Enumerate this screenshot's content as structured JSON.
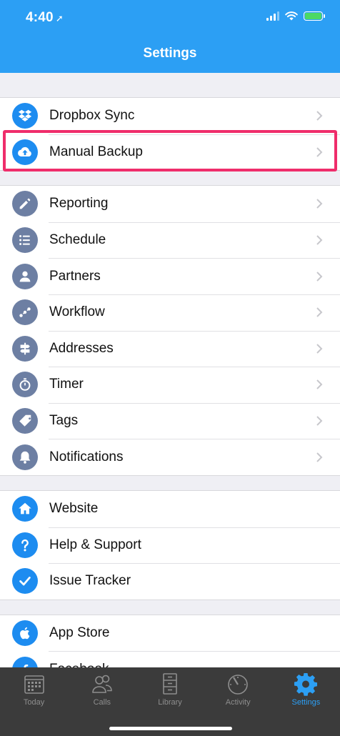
{
  "status_bar": {
    "time": "4:40",
    "location_glyph": "➚"
  },
  "nav": {
    "title": "Settings"
  },
  "sections": [
    {
      "items": [
        {
          "label": "Dropbox Sync",
          "icon": "dropbox-icon",
          "color": "#1d8cf0"
        },
        {
          "label": "Manual Backup",
          "icon": "cloud-upload-icon",
          "color": "#1d8cf0",
          "highlighted": true
        }
      ]
    },
    {
      "items": [
        {
          "label": "Reporting",
          "icon": "pencil-icon",
          "color": "#6d7fa3"
        },
        {
          "label": "Schedule",
          "icon": "list-icon",
          "color": "#6d7fa3"
        },
        {
          "label": "Partners",
          "icon": "person-icon",
          "color": "#6d7fa3"
        },
        {
          "label": "Workflow",
          "icon": "workflow-icon",
          "color": "#6d7fa3"
        },
        {
          "label": "Addresses",
          "icon": "signpost-icon",
          "color": "#6d7fa3"
        },
        {
          "label": "Timer",
          "icon": "stopwatch-icon",
          "color": "#6d7fa3"
        },
        {
          "label": "Tags",
          "icon": "tag-icon",
          "color": "#6d7fa3"
        },
        {
          "label": "Notifications",
          "icon": "bell-icon",
          "color": "#6d7fa3"
        }
      ]
    },
    {
      "items": [
        {
          "label": "Website",
          "icon": "home-icon",
          "color": "#1d8cf0"
        },
        {
          "label": "Help & Support",
          "icon": "question-icon",
          "color": "#1d8cf0"
        },
        {
          "label": "Issue Tracker",
          "icon": "checkmark-icon",
          "color": "#1d8cf0"
        }
      ]
    },
    {
      "items": [
        {
          "label": "App Store",
          "icon": "apple-icon",
          "color": "#1d8cf0"
        },
        {
          "label": "Facebook",
          "icon": "facebook-icon",
          "color": "#1d8cf0"
        }
      ]
    }
  ],
  "tabbar": {
    "tabs": [
      {
        "label": "Today",
        "icon": "calendar-icon",
        "active": false
      },
      {
        "label": "Calls",
        "icon": "people-icon",
        "active": false
      },
      {
        "label": "Library",
        "icon": "cabinet-icon",
        "active": false
      },
      {
        "label": "Activity",
        "icon": "gauge-icon",
        "active": false
      },
      {
        "label": "Settings",
        "icon": "gear-icon",
        "active": true
      }
    ],
    "active_color": "#2c9ff4",
    "inactive_color": "#8e8e8e"
  },
  "highlight_color": "#ef2d6b"
}
